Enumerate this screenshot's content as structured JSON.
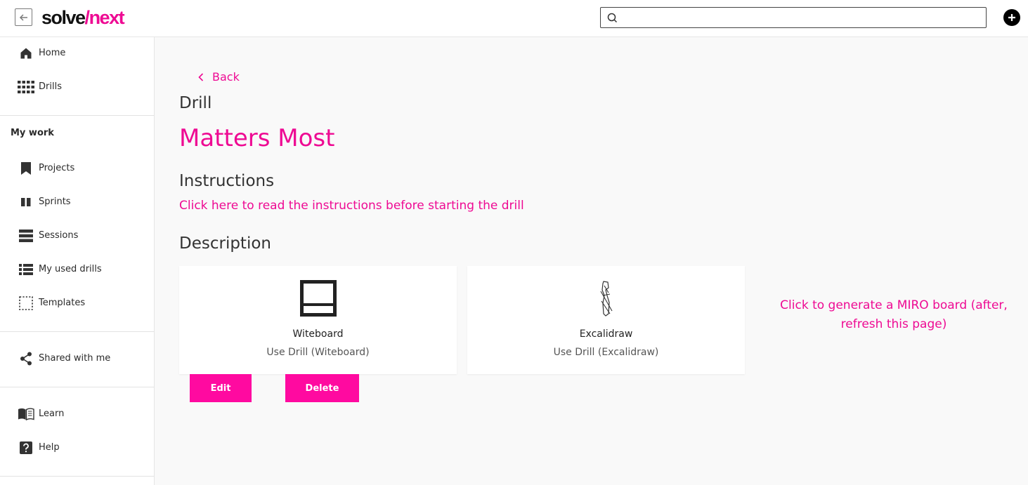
{
  "header": {
    "logo": {
      "solve": "solve",
      "slash": "/",
      "next": "next"
    },
    "search": {
      "value": "",
      "placeholder": ""
    },
    "icons": {
      "collapse": "arrow-left-icon",
      "search": "search-icon",
      "add": "plus-circle-icon"
    }
  },
  "sidebar": {
    "top_items": [
      {
        "label": "Home",
        "icon": "home-icon"
      },
      {
        "label": "Drills",
        "icon": "grid-icon"
      }
    ],
    "my_work_title": "My work",
    "work_items": [
      {
        "label": "Projects",
        "icon": "bookmark-icon"
      },
      {
        "label": "Sprints",
        "icon": "columns-icon"
      },
      {
        "label": "Sessions",
        "icon": "rows-icon"
      },
      {
        "label": "My used drills",
        "icon": "list-icon"
      },
      {
        "label": "Templates",
        "icon": "dashed-square-icon"
      }
    ],
    "shared_item": {
      "label": "Shared with me",
      "icon": "share-icon"
    },
    "bottom_items": [
      {
        "label": "Learn",
        "icon": "book-icon"
      },
      {
        "label": "Help",
        "icon": "help-icon"
      }
    ]
  },
  "main": {
    "back_label": "Back",
    "kicker": "Drill",
    "title": "Matters Most",
    "instructions_heading": "Instructions",
    "instructions_link": "Click here to read the instructions before starting the drill",
    "description_heading": "Description",
    "cards": [
      {
        "name": "Witeboard",
        "subtitle": "Use Drill (Witeboard)",
        "icon": "whiteboard-icon"
      },
      {
        "name": "Excalidraw",
        "subtitle": "Use Drill (Excalidraw)",
        "icon": "excalidraw-icon"
      }
    ],
    "edit_label": "Edit",
    "delete_label": "Delete",
    "miro_link": "Click to generate a MIRO board (after, refresh this page)"
  },
  "colors": {
    "accent": "#ee0a93",
    "button": "#ff0aa0"
  }
}
